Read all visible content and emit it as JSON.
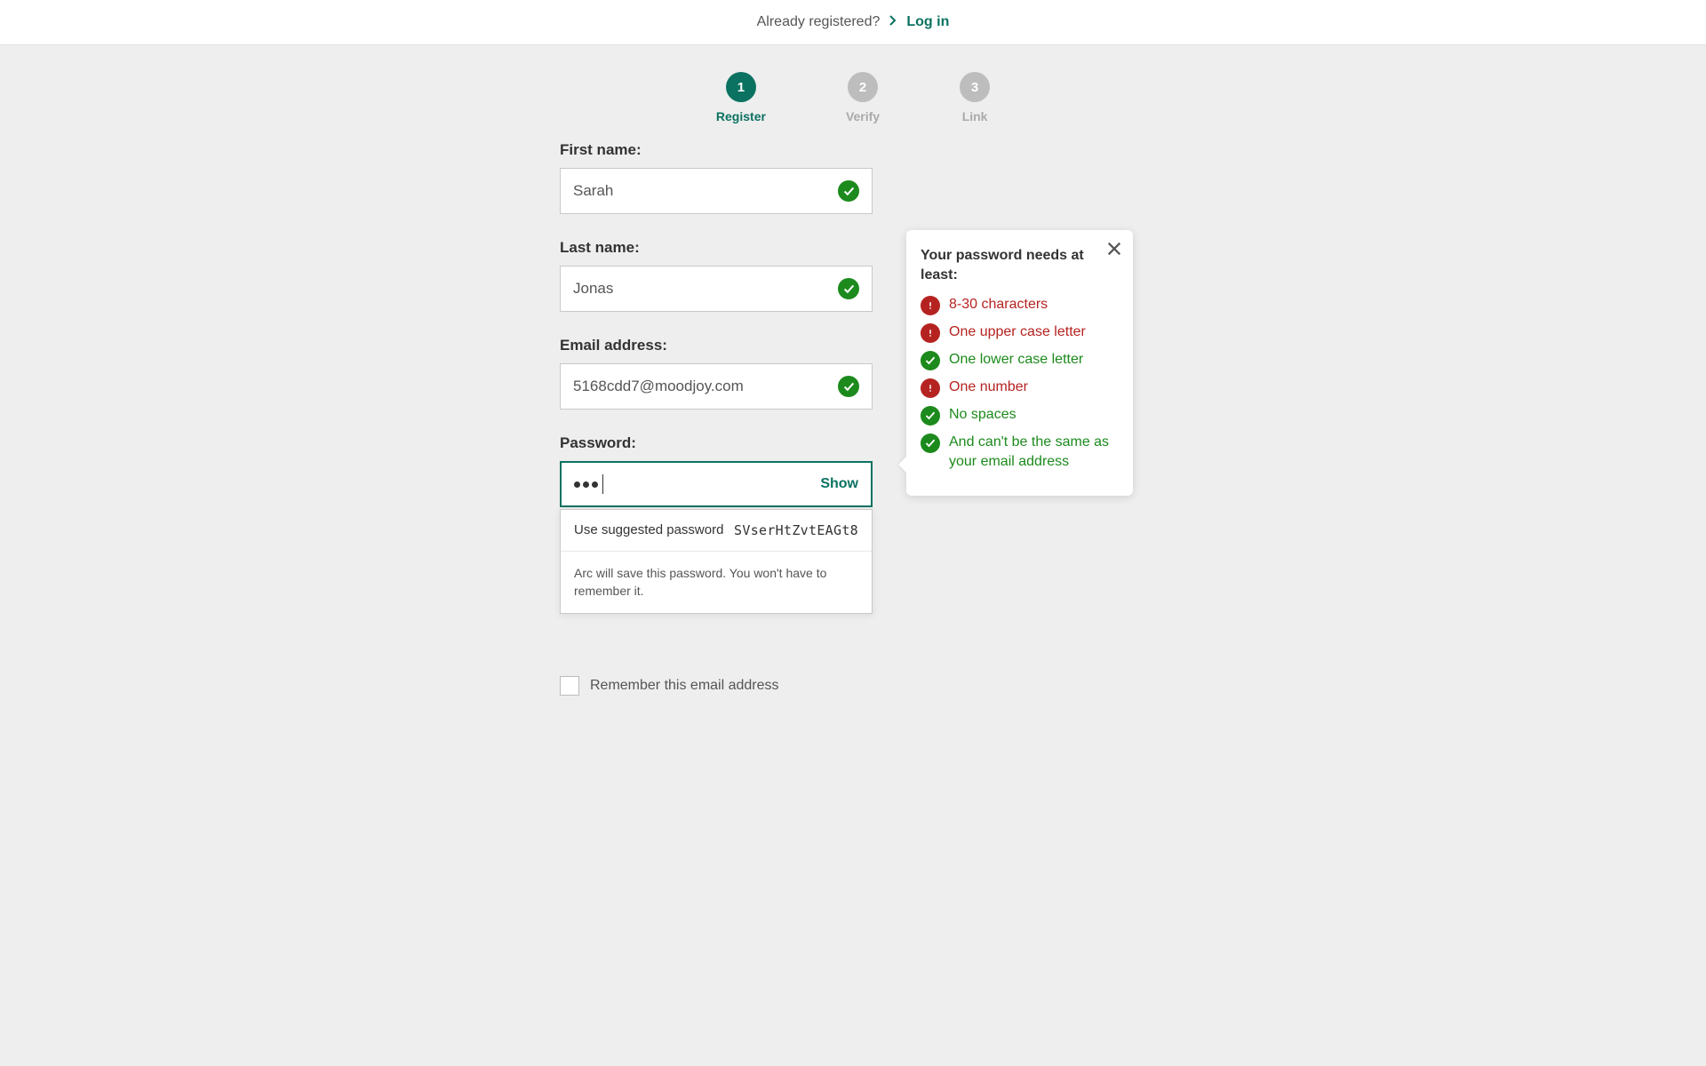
{
  "topbar": {
    "already_registered": "Already registered?",
    "login_label": "Log in"
  },
  "stepper": [
    {
      "num": "1",
      "label": "Register",
      "active": true
    },
    {
      "num": "2",
      "label": "Verify",
      "active": false
    },
    {
      "num": "3",
      "label": "Link",
      "active": false
    }
  ],
  "fields": {
    "first_name": {
      "label": "First name:",
      "value": "Sarah"
    },
    "last_name": {
      "label": "Last name:",
      "value": "Jonas"
    },
    "email": {
      "label": "Email address:",
      "value": "5168cdd7@moodjoy.com"
    },
    "password": {
      "label": "Password:",
      "show_btn": "Show",
      "value": "•••"
    }
  },
  "suggestion": {
    "label": "Use suggested password",
    "value": "SVserHtZvtEAGt8",
    "note": "Arc will save this password. You won't have to remember it."
  },
  "tooltip": {
    "title": "Your password needs at least:",
    "rules": [
      {
        "text": "8-30 characters",
        "pass": false
      },
      {
        "text": "One upper case letter",
        "pass": false
      },
      {
        "text": "One lower case letter",
        "pass": true
      },
      {
        "text": "One number",
        "pass": false
      },
      {
        "text": "No spaces",
        "pass": true
      },
      {
        "text": "And can't be the same as your email address",
        "pass": true
      }
    ]
  },
  "remember": {
    "label": "Remember this email address"
  }
}
